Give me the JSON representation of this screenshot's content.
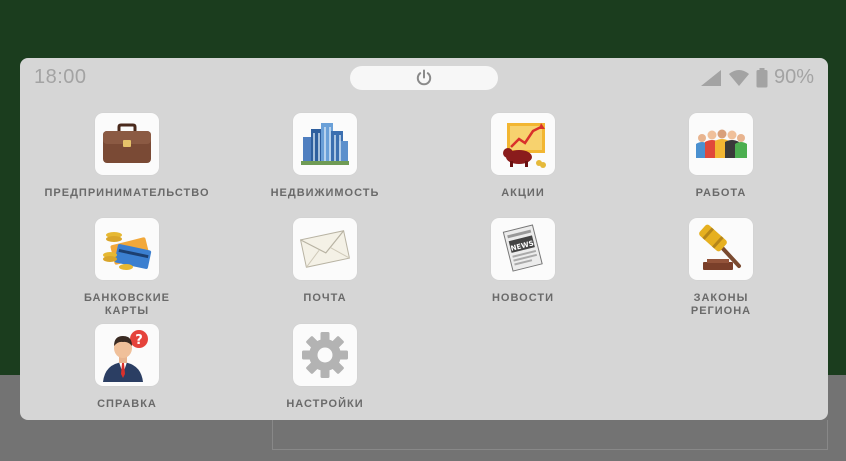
{
  "status_bar": {
    "time": "18:00",
    "battery": "90%"
  },
  "apps": [
    {
      "label": "ПРЕДПРИНИМАТЕЛЬСТВО",
      "icon": "briefcase-icon"
    },
    {
      "label": "НЕДВИЖИМОСТЬ",
      "icon": "buildings-icon"
    },
    {
      "label": "АКЦИИ",
      "icon": "stock-bull-icon"
    },
    {
      "label": "РАБОТА",
      "icon": "people-icon"
    },
    {
      "label": "БАНКОВСКИЕ\nКАРТЫ",
      "icon": "bank-cards-icon"
    },
    {
      "label": "ПОЧТА",
      "icon": "envelope-icon"
    },
    {
      "label": "НОВОСТИ",
      "icon": "newspaper-icon"
    },
    {
      "label": "ЗАКОНЫ\nРЕГИОНА",
      "icon": "gavel-icon"
    },
    {
      "label": "СПРАВКА",
      "icon": "help-person-icon"
    },
    {
      "label": "НАСТРОЙКИ",
      "icon": "gear-icon"
    }
  ],
  "colors": {
    "panel": "#d6d6d6",
    "background_top": "#1b3d1e",
    "background_bottom": "#737373",
    "label": "#6a6a6a"
  }
}
